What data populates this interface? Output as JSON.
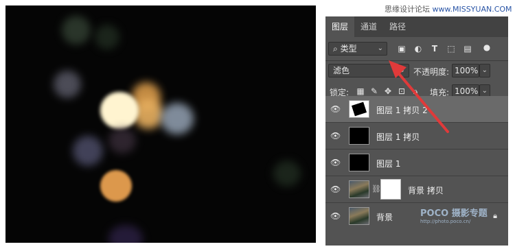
{
  "watermark": {
    "text": "思缘设计论坛 ",
    "url": "www.MISSYUAN.COM"
  },
  "tabs": [
    {
      "label": "图层"
    },
    {
      "label": "通道"
    },
    {
      "label": "路径"
    }
  ],
  "filter": {
    "label": "类型",
    "icon": "search-icon"
  },
  "blend_mode": {
    "value": "滤色"
  },
  "opacity": {
    "label": "不透明度:",
    "value": "100%"
  },
  "lock": {
    "label": "锁定:"
  },
  "fill": {
    "label": "填充:",
    "value": "100%"
  },
  "layers": [
    {
      "name": "图层 1 拷贝 2",
      "thumb": "black-shape",
      "selected": true
    },
    {
      "name": "图层 1 拷贝",
      "thumb": "black"
    },
    {
      "name": "图层 1",
      "thumb": "black"
    },
    {
      "name": "背景 拷贝",
      "thumb": "photo",
      "mask": true
    },
    {
      "name": "背景",
      "thumb": "photo",
      "locked": true
    }
  ],
  "poco": {
    "brand": "POCO 摄影专题",
    "url": "http://photo.poco.cn/"
  },
  "colors": {
    "panel": "#535353",
    "arrow": "#e03a3a",
    "selected_row": "#6a6a6a"
  }
}
